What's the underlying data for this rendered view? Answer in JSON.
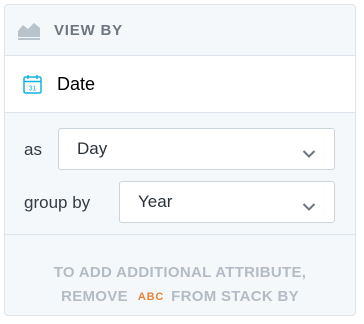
{
  "header": {
    "title": "View by",
    "icon": "area-chart-icon"
  },
  "attribute": {
    "label": "Date",
    "icon": "calendar-icon",
    "calendar_day": "31"
  },
  "as_row": {
    "label": "as",
    "value": "Day"
  },
  "group_by_row": {
    "label": "group by",
    "value": "Year"
  },
  "footer": {
    "line1": "To add additional attribute,",
    "line2_prefix": "remove",
    "badge": "ABC",
    "line2_suffix": "from stack by"
  },
  "colors": {
    "accent": "#14b2e2",
    "badge": "#e8843a",
    "muted": "#b3bcc5"
  }
}
